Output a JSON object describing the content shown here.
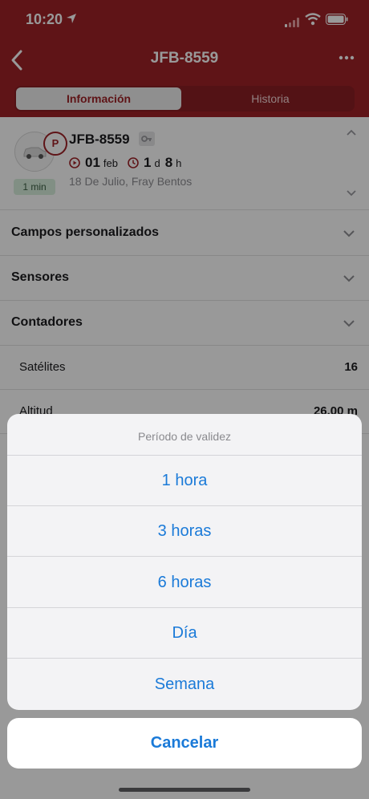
{
  "status": {
    "time": "10:20"
  },
  "nav": {
    "title": "JFB-8559"
  },
  "tabs": [
    {
      "label": "Información"
    },
    {
      "label": "Historia"
    }
  ],
  "unit": {
    "name": "JFB-8559",
    "parking_badge": "P",
    "age_badge": "1 min",
    "trip_start_day": "01",
    "trip_start_month": "feb",
    "duration_days": "1",
    "duration_days_unit": "d",
    "duration_hours": "8",
    "duration_hours_unit": "h",
    "address": "18 De Julio, Fray Bentos"
  },
  "sections": [
    {
      "label": "Campos personalizados"
    },
    {
      "label": "Sensores"
    },
    {
      "label": "Contadores"
    }
  ],
  "fields": [
    {
      "key": "Satélites",
      "value": "16"
    },
    {
      "key": "Altitud",
      "value": "26.00 m"
    }
  ],
  "sheet": {
    "title": "Período de validez",
    "options": [
      "1 hora",
      "3 horas",
      "6 horas",
      "Día",
      "Semana"
    ],
    "cancel": "Cancelar"
  },
  "colors": {
    "brand": "#9e2227",
    "action": "#1a7ad8",
    "badge_green": "#d8eedd"
  }
}
